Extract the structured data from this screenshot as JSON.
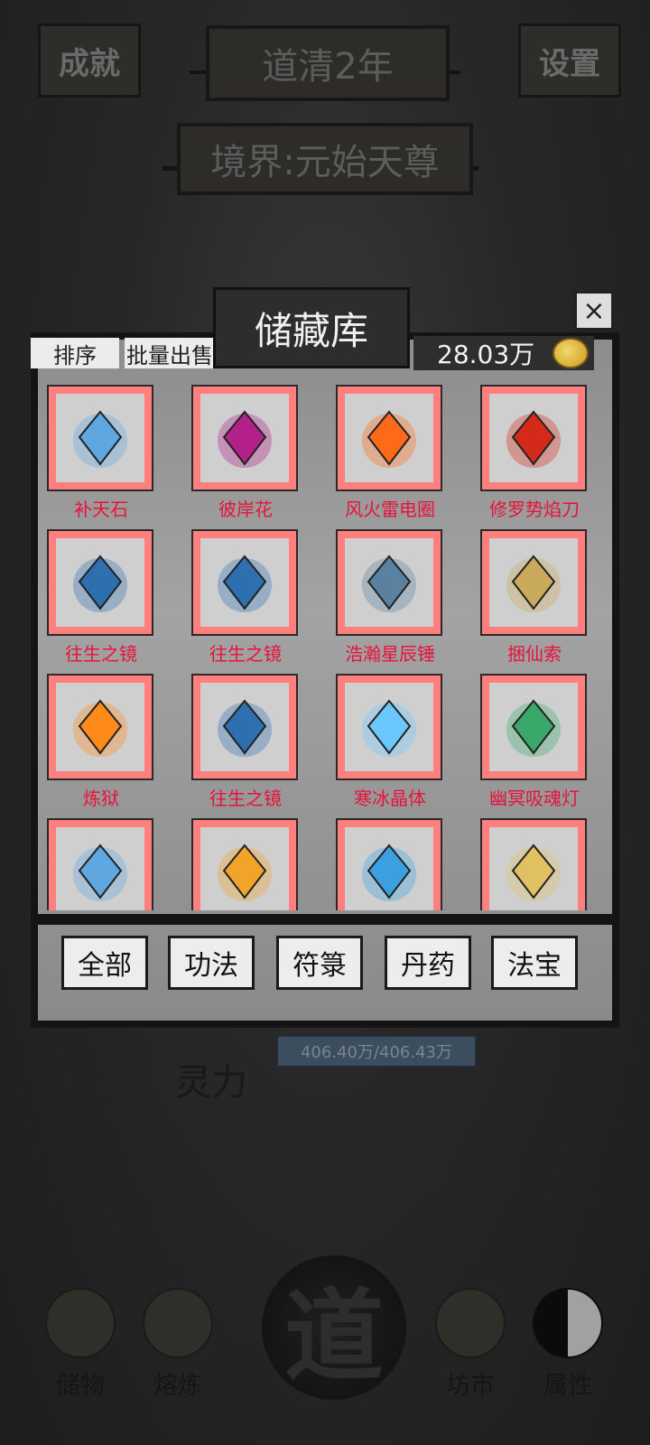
{
  "hud": {
    "achievement_label": "成就",
    "year_label": "道清2年",
    "settings_label": "设置",
    "realm_label": "境界:元始天尊"
  },
  "stats": {
    "spirit_label": "灵力",
    "spirit_value": "406.40万/406.43万"
  },
  "storage": {
    "title": "储藏库",
    "close_label": "×",
    "sort_label": "排序",
    "bulk_sell_label": "批量出售",
    "money": "28.03万",
    "items": [
      {
        "name": "补天石",
        "icon": "crystal-icon",
        "color": "#5fa7e0"
      },
      {
        "name": "彼岸花",
        "icon": "flower-icon",
        "color": "#b3208a"
      },
      {
        "name": "风火雷电圈",
        "icon": "fire-ring-icon",
        "color": "#ff6a1a"
      },
      {
        "name": "修罗势焰刀",
        "icon": "flame-blade-icon",
        "color": "#d42a1a"
      },
      {
        "name": "往生之镜",
        "icon": "mirror-icon",
        "color": "#2e6fb0"
      },
      {
        "name": "往生之镜",
        "icon": "mirror-icon",
        "color": "#2e6fb0"
      },
      {
        "name": "浩瀚星辰锤",
        "icon": "hammer-icon",
        "color": "#5a82a0"
      },
      {
        "name": "捆仙索",
        "icon": "rope-icon",
        "color": "#c9a95a"
      },
      {
        "name": "炼狱",
        "icon": "fire-icon",
        "color": "#ff8a1a"
      },
      {
        "name": "往生之镜",
        "icon": "mirror-icon",
        "color": "#2e6fb0"
      },
      {
        "name": "寒冰晶体",
        "icon": "ice-crystal-icon",
        "color": "#6ac8ff"
      },
      {
        "name": "幽冥吸魂灯",
        "icon": "ghost-lamp-icon",
        "color": "#3aa86a"
      },
      {
        "name": "",
        "icon": "crystal-icon",
        "color": "#5fa7e0"
      },
      {
        "name": "",
        "icon": "staff-icon",
        "color": "#f2a32a"
      },
      {
        "name": "",
        "icon": "turtle-chest-icon",
        "color": "#3aa0e0"
      },
      {
        "name": "",
        "icon": "bell-icon",
        "color": "#e0c060"
      }
    ],
    "tabs": [
      "全部",
      "功法",
      "符箓",
      "丹药",
      "法宝"
    ]
  },
  "nav": {
    "storage": "储物",
    "forge": "熔炼",
    "center": "道",
    "market": "坊市",
    "attributes": "属性"
  }
}
